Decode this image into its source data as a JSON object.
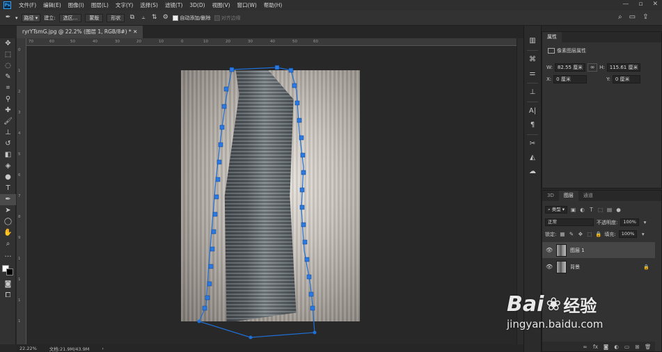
{
  "menubar": {
    "logo": "Ps",
    "items": [
      "文件(F)",
      "编辑(E)",
      "图像(I)",
      "图层(L)",
      "文字(Y)",
      "选择(S)",
      "滤镜(T)",
      "3D(D)",
      "视图(V)",
      "窗口(W)",
      "帮助(H)"
    ],
    "minimize": "—",
    "maximize": "▫",
    "close": "✕"
  },
  "options": {
    "mode": "路径",
    "make_label": "建立:",
    "selection_btn": "选区...",
    "mask_btn": "蒙版",
    "shape_btn": "形状",
    "auto_add": "自动添加/删除",
    "align_edges": "对齐边缘"
  },
  "document": {
    "tab_title": "ryrYTsmG.jpg @ 22.2% (图层 1, RGB/8#) *",
    "ruler_h": [
      "70",
      "60",
      "50",
      "40",
      "30",
      "20",
      "10",
      "0",
      "10",
      "20",
      "30",
      "40",
      "50",
      "60"
    ],
    "ruler_v": [
      "0",
      "1",
      "2",
      "3",
      "4",
      "5",
      "6",
      "7",
      "8",
      "9",
      "1",
      "1",
      "1",
      "1"
    ]
  },
  "status": {
    "zoom": "22.22%",
    "doc_size": "文档:21.9M/43.9M"
  },
  "properties": {
    "tab": "属性",
    "section_title": "像素图层属性",
    "w_label": "W:",
    "w_value": "82.55 厘米",
    "h_label": "H:",
    "h_value": "115.61 厘米",
    "x_label": "X:",
    "x_value": "0 厘米",
    "y_label": "Y:",
    "y_value": "0 厘米"
  },
  "layers": {
    "tabs": [
      "3D",
      "图层",
      "通道"
    ],
    "filter_kind": "类型",
    "blend_mode": "正常",
    "opacity_label": "不透明度:",
    "opacity": "100%",
    "lock_label": "锁定:",
    "fill_label": "填充:",
    "fill": "100%",
    "items": [
      {
        "name": "图层 1",
        "selected": true
      },
      {
        "name": "背景",
        "selected": false
      }
    ]
  },
  "watermark": {
    "brand_left": "Bai",
    "brand_right": "经验",
    "url": "jingyan.baidu.com"
  },
  "colors": {
    "accent": "#31a8ff",
    "path": "#1f6fd6"
  }
}
